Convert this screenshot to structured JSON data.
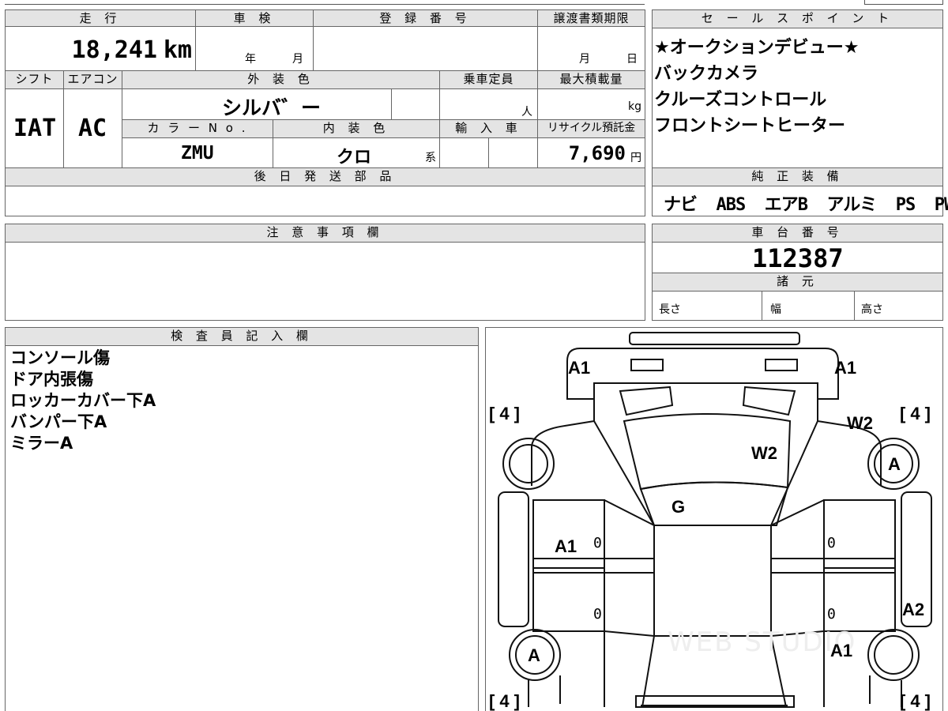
{
  "header": {
    "mileage_label": "走 行",
    "mileage_value": "18,241",
    "mileage_unit": "km",
    "inspection_label": "車 検",
    "inspection_year": "年",
    "inspection_month": "月",
    "registration_label": "登 録 番 号",
    "transfer_label": "譲渡書類期限",
    "transfer_month": "月",
    "transfer_day": "日"
  },
  "specs": {
    "shift_label": "シフト",
    "shift_value": "IAT",
    "ac_label": "エアコン",
    "ac_value": "AC",
    "exterior_label": "外 装 色",
    "exterior_value": "シルバ゛ー",
    "capacity_label": "乗車定員",
    "capacity_unit": "人",
    "maxload_label": "最大積載量",
    "maxload_unit": "kg",
    "color_no_label": "カ ラ ー N o .",
    "color_no_value": "ZMU",
    "interior_label": "内 装 色",
    "interior_value": "クロ",
    "interior_suffix": "系",
    "import_label": "輸 入 車",
    "recycle_label": "リサイクル預託金",
    "recycle_value": "7,690",
    "recycle_unit": "円",
    "later_parts_label": "後 日 発 送 部 品"
  },
  "sales_points": {
    "label": "セ ー ル ス ポ イ ン ト",
    "items": [
      "★オークションデビュー★",
      "バックカメラ",
      "クルーズコントロール",
      "フロントシートヒーター"
    ]
  },
  "equipment": {
    "label": "純 正 装 備",
    "value": "ナビ  ABS  エアB  アルミ  PS  PW"
  },
  "notes": {
    "label": "注 意 事 項 欄"
  },
  "chassis": {
    "label": "車 台 番 号",
    "value": "112387"
  },
  "dimensions": {
    "label": "諸 元",
    "length": "長さ",
    "width": "幅",
    "height": "高さ"
  },
  "inspector": {
    "label": "検 査 員 記 入 欄",
    "items": [
      "コンソール傷",
      "ドア内張傷",
      "ロッカーカバー下A",
      "バンパー下A",
      "ミラーA"
    ]
  },
  "diagram": {
    "marks": {
      "front_left_corner": "A1",
      "front_right_corner": "A1",
      "windshield": "W2",
      "right_front_window": "W2",
      "roof_glass": "G",
      "left_front_door": "A1",
      "right_front_wheel": "A",
      "left_rear_wheel": "A",
      "right_rocker": "A2",
      "right_rear_door": "A1"
    },
    "tire_tread": {
      "front_left": "4",
      "front_right": "4",
      "rear_left": "4",
      "rear_right": "4"
    },
    "door_zero": "0",
    "watermark": "WEB STUDIO"
  }
}
